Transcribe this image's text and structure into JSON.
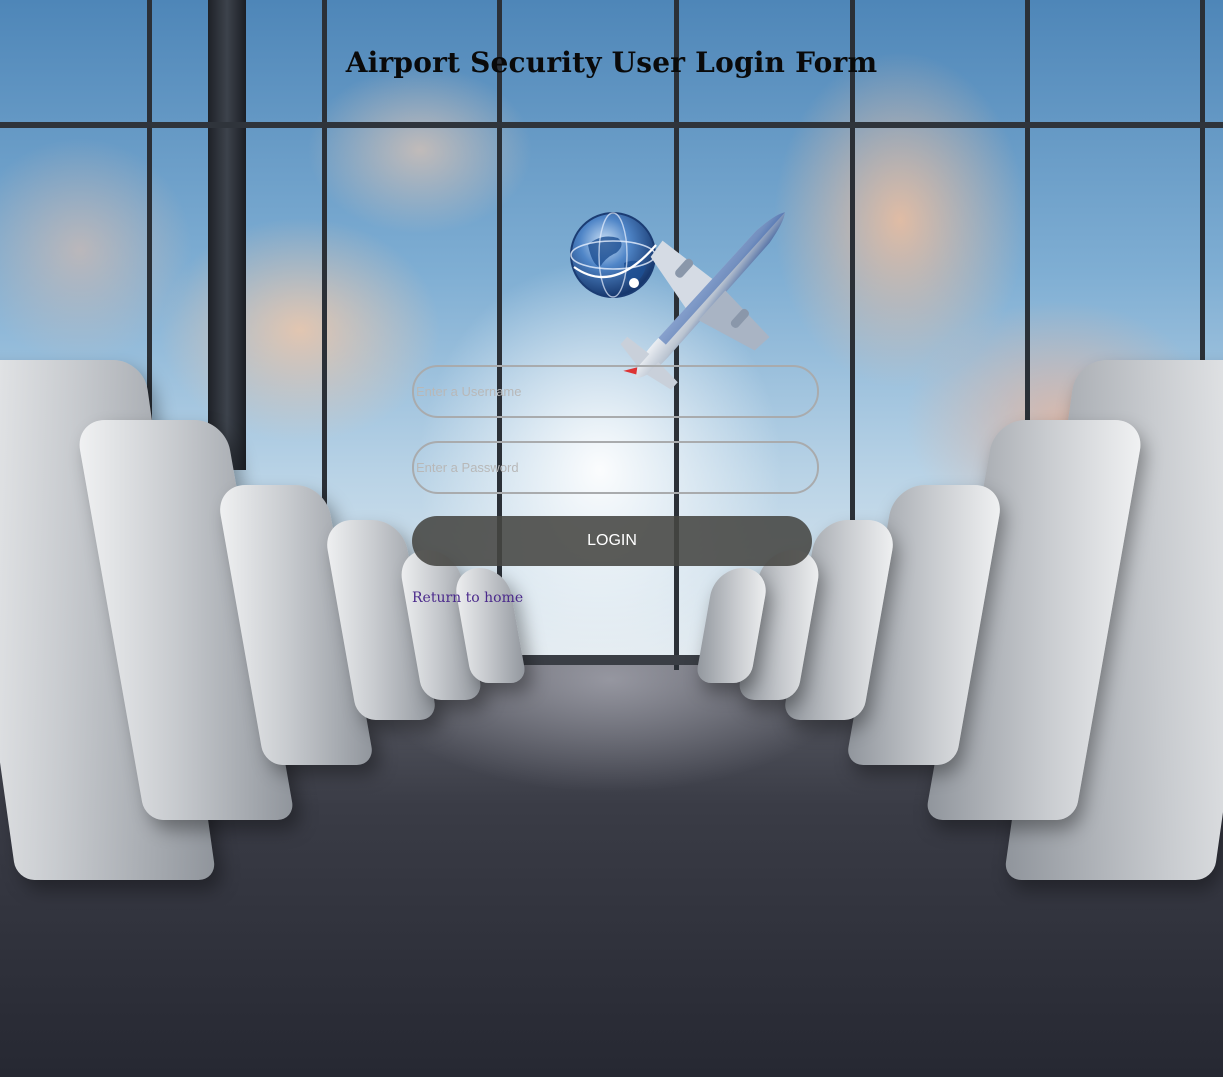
{
  "page": {
    "title": "Airport Security User Login Form"
  },
  "form": {
    "username_placeholder": "Enter a Username",
    "username_value": "",
    "password_placeholder": "Enter a Password",
    "password_value": "",
    "login_label": "LOGIN",
    "return_link_label": "Return to home"
  },
  "icons": {
    "logo": "globe-airplane-logo"
  },
  "colors": {
    "button_bg": "#464642",
    "button_text": "#ffffff",
    "link": "#4b2a8c",
    "field_border": "#a9abad",
    "title": "#0a0a0a"
  }
}
